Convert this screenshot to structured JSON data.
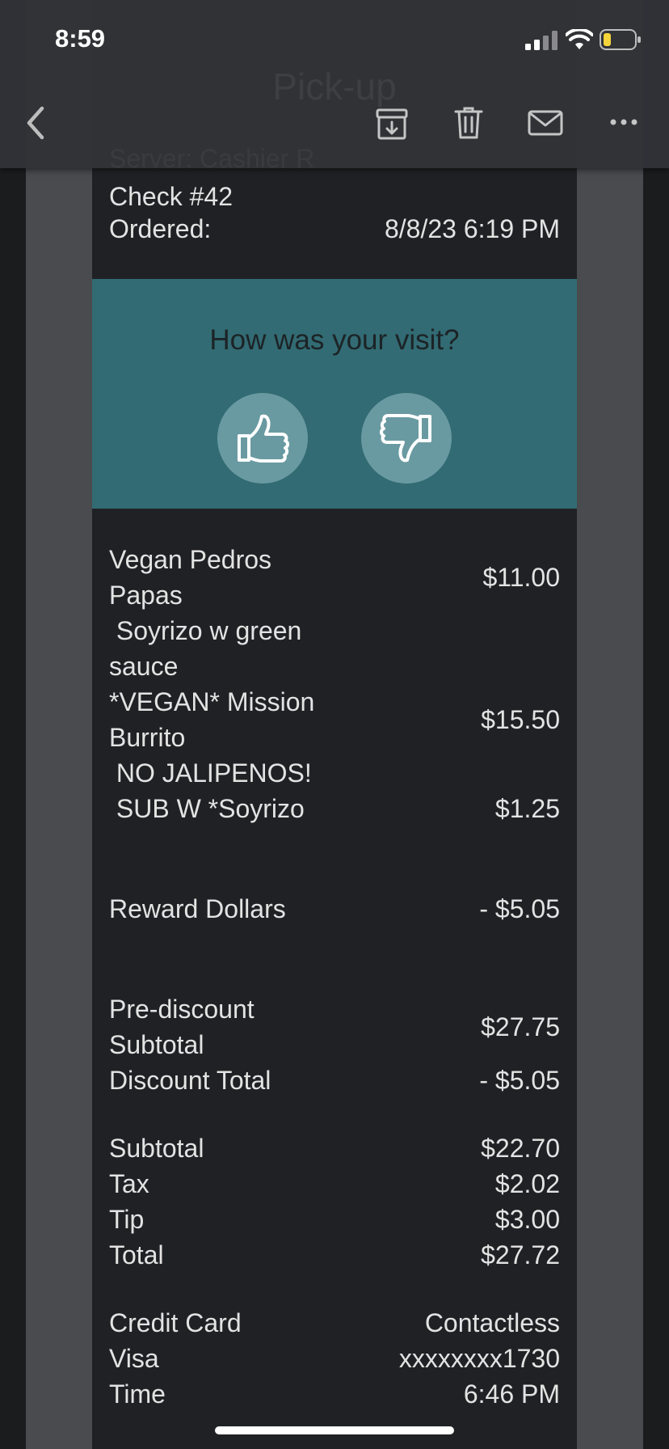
{
  "status_bar": {
    "time": "8:59"
  },
  "nav": {
    "title": "Pick-up"
  },
  "receipt": {
    "server_line": "Server: Cashier R",
    "check": "Check #42",
    "ordered_label": "Ordered:",
    "ordered_value": "8/8/23 6:19 PM",
    "feedback_question": "How was your visit?",
    "items": [
      {
        "name_line1": "Vegan Pedros",
        "name_line2": "Papas",
        "price": "$11.00"
      },
      {
        "mod_line1": " Soyrizo w green",
        "mod_line2": "sauce"
      },
      {
        "name_line1": "*VEGAN* Mission",
        "name_line2": "Burrito",
        "price": "$15.50"
      },
      {
        "mod": " NO JALIPENOS!"
      },
      {
        "mod": " SUB W *Soyrizo",
        "price": "$1.25"
      }
    ],
    "reward_label": "Reward Dollars",
    "reward_value": "- $5.05",
    "prediscount_label1": "Pre-discount",
    "prediscount_label2": "Subtotal",
    "prediscount_value": "$27.75",
    "discount_label": "Discount Total",
    "discount_value": "- $5.05",
    "subtotal_label": "Subtotal",
    "subtotal_value": "$22.70",
    "tax_label": "Tax",
    "tax_value": "$2.02",
    "tip_label": "Tip",
    "tip_value": "$3.00",
    "total_label": "Total",
    "total_value": "$27.72",
    "payment_label": "Credit Card",
    "payment_value": "Contactless",
    "card_label": "Visa",
    "card_value": "xxxxxxxx1730",
    "time_label": "Time",
    "time_value": "6:46 PM"
  },
  "colors": {
    "accent_teal": "#326b73",
    "battery_low": "#f5d33a"
  }
}
